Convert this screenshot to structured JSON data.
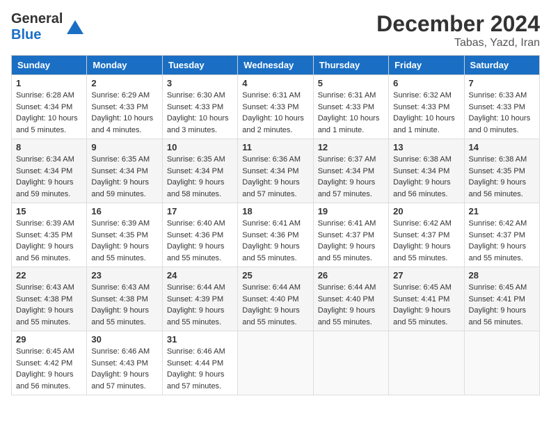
{
  "header": {
    "logo_general": "General",
    "logo_blue": "Blue",
    "month_title": "December 2024",
    "location": "Tabas, Yazd, Iran"
  },
  "weekdays": [
    "Sunday",
    "Monday",
    "Tuesday",
    "Wednesday",
    "Thursday",
    "Friday",
    "Saturday"
  ],
  "weeks": [
    [
      {
        "day": "1",
        "sunrise": "Sunrise: 6:28 AM",
        "sunset": "Sunset: 4:34 PM",
        "daylight": "Daylight: 10 hours and 5 minutes."
      },
      {
        "day": "2",
        "sunrise": "Sunrise: 6:29 AM",
        "sunset": "Sunset: 4:33 PM",
        "daylight": "Daylight: 10 hours and 4 minutes."
      },
      {
        "day": "3",
        "sunrise": "Sunrise: 6:30 AM",
        "sunset": "Sunset: 4:33 PM",
        "daylight": "Daylight: 10 hours and 3 minutes."
      },
      {
        "day": "4",
        "sunrise": "Sunrise: 6:31 AM",
        "sunset": "Sunset: 4:33 PM",
        "daylight": "Daylight: 10 hours and 2 minutes."
      },
      {
        "day": "5",
        "sunrise": "Sunrise: 6:31 AM",
        "sunset": "Sunset: 4:33 PM",
        "daylight": "Daylight: 10 hours and 1 minute."
      },
      {
        "day": "6",
        "sunrise": "Sunrise: 6:32 AM",
        "sunset": "Sunset: 4:33 PM",
        "daylight": "Daylight: 10 hours and 1 minute."
      },
      {
        "day": "7",
        "sunrise": "Sunrise: 6:33 AM",
        "sunset": "Sunset: 4:33 PM",
        "daylight": "Daylight: 10 hours and 0 minutes."
      }
    ],
    [
      {
        "day": "8",
        "sunrise": "Sunrise: 6:34 AM",
        "sunset": "Sunset: 4:34 PM",
        "daylight": "Daylight: 9 hours and 59 minutes."
      },
      {
        "day": "9",
        "sunrise": "Sunrise: 6:35 AM",
        "sunset": "Sunset: 4:34 PM",
        "daylight": "Daylight: 9 hours and 59 minutes."
      },
      {
        "day": "10",
        "sunrise": "Sunrise: 6:35 AM",
        "sunset": "Sunset: 4:34 PM",
        "daylight": "Daylight: 9 hours and 58 minutes."
      },
      {
        "day": "11",
        "sunrise": "Sunrise: 6:36 AM",
        "sunset": "Sunset: 4:34 PM",
        "daylight": "Daylight: 9 hours and 57 minutes."
      },
      {
        "day": "12",
        "sunrise": "Sunrise: 6:37 AM",
        "sunset": "Sunset: 4:34 PM",
        "daylight": "Daylight: 9 hours and 57 minutes."
      },
      {
        "day": "13",
        "sunrise": "Sunrise: 6:38 AM",
        "sunset": "Sunset: 4:34 PM",
        "daylight": "Daylight: 9 hours and 56 minutes."
      },
      {
        "day": "14",
        "sunrise": "Sunrise: 6:38 AM",
        "sunset": "Sunset: 4:35 PM",
        "daylight": "Daylight: 9 hours and 56 minutes."
      }
    ],
    [
      {
        "day": "15",
        "sunrise": "Sunrise: 6:39 AM",
        "sunset": "Sunset: 4:35 PM",
        "daylight": "Daylight: 9 hours and 56 minutes."
      },
      {
        "day": "16",
        "sunrise": "Sunrise: 6:39 AM",
        "sunset": "Sunset: 4:35 PM",
        "daylight": "Daylight: 9 hours and 55 minutes."
      },
      {
        "day": "17",
        "sunrise": "Sunrise: 6:40 AM",
        "sunset": "Sunset: 4:36 PM",
        "daylight": "Daylight: 9 hours and 55 minutes."
      },
      {
        "day": "18",
        "sunrise": "Sunrise: 6:41 AM",
        "sunset": "Sunset: 4:36 PM",
        "daylight": "Daylight: 9 hours and 55 minutes."
      },
      {
        "day": "19",
        "sunrise": "Sunrise: 6:41 AM",
        "sunset": "Sunset: 4:37 PM",
        "daylight": "Daylight: 9 hours and 55 minutes."
      },
      {
        "day": "20",
        "sunrise": "Sunrise: 6:42 AM",
        "sunset": "Sunset: 4:37 PM",
        "daylight": "Daylight: 9 hours and 55 minutes."
      },
      {
        "day": "21",
        "sunrise": "Sunrise: 6:42 AM",
        "sunset": "Sunset: 4:37 PM",
        "daylight": "Daylight: 9 hours and 55 minutes."
      }
    ],
    [
      {
        "day": "22",
        "sunrise": "Sunrise: 6:43 AM",
        "sunset": "Sunset: 4:38 PM",
        "daylight": "Daylight: 9 hours and 55 minutes."
      },
      {
        "day": "23",
        "sunrise": "Sunrise: 6:43 AM",
        "sunset": "Sunset: 4:38 PM",
        "daylight": "Daylight: 9 hours and 55 minutes."
      },
      {
        "day": "24",
        "sunrise": "Sunrise: 6:44 AM",
        "sunset": "Sunset: 4:39 PM",
        "daylight": "Daylight: 9 hours and 55 minutes."
      },
      {
        "day": "25",
        "sunrise": "Sunrise: 6:44 AM",
        "sunset": "Sunset: 4:40 PM",
        "daylight": "Daylight: 9 hours and 55 minutes."
      },
      {
        "day": "26",
        "sunrise": "Sunrise: 6:44 AM",
        "sunset": "Sunset: 4:40 PM",
        "daylight": "Daylight: 9 hours and 55 minutes."
      },
      {
        "day": "27",
        "sunrise": "Sunrise: 6:45 AM",
        "sunset": "Sunset: 4:41 PM",
        "daylight": "Daylight: 9 hours and 55 minutes."
      },
      {
        "day": "28",
        "sunrise": "Sunrise: 6:45 AM",
        "sunset": "Sunset: 4:41 PM",
        "daylight": "Daylight: 9 hours and 56 minutes."
      }
    ],
    [
      {
        "day": "29",
        "sunrise": "Sunrise: 6:45 AM",
        "sunset": "Sunset: 4:42 PM",
        "daylight": "Daylight: 9 hours and 56 minutes."
      },
      {
        "day": "30",
        "sunrise": "Sunrise: 6:46 AM",
        "sunset": "Sunset: 4:43 PM",
        "daylight": "Daylight: 9 hours and 57 minutes."
      },
      {
        "day": "31",
        "sunrise": "Sunrise: 6:46 AM",
        "sunset": "Sunset: 4:44 PM",
        "daylight": "Daylight: 9 hours and 57 minutes."
      },
      null,
      null,
      null,
      null
    ]
  ]
}
